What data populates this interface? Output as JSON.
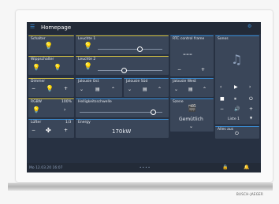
{
  "header": {
    "title": "Homepage"
  },
  "tiles": {
    "schalter": {
      "label": "Schalter"
    },
    "leuchte1": {
      "label": "Leuchte 1"
    },
    "rtc": {
      "label": "RTC control frame",
      "value": "---",
      "minus": "−",
      "plus": "+"
    },
    "sonos": {
      "label": "Sonos",
      "source": "Liste 1"
    },
    "wippschalter": {
      "label": "Wippschalter"
    },
    "leuchte2": {
      "label": "Leuchte 2"
    },
    "dimmer": {
      "label": "Dimmer"
    },
    "jalousie_ost": {
      "label": "Jalousie Ost"
    },
    "jalousie_sued": {
      "label": "Jalousie Süd"
    },
    "jalousie_west": {
      "label": "Jalousie West"
    },
    "rgbw": {
      "label": "RGBW",
      "value": "100%"
    },
    "helligkeit": {
      "label": "Helligkeitsschwelle"
    },
    "szene": {
      "label": "Szene",
      "value": "Gemütlich"
    },
    "luefter": {
      "label": "Lüfter",
      "value": "1/3"
    },
    "energy": {
      "label": "Energy",
      "value": "170kW"
    },
    "alles_aus": {
      "label": "Alles aus"
    }
  },
  "status": {
    "datetime": "Mo 12.03.20  16:07"
  },
  "brand": "BUSCH-JAEGER",
  "colors": {
    "accent_green": "#7fc04a",
    "accent_yellow": "#d8c542",
    "accent_blue": "#3a8fd8",
    "accent_orange": "#e38b2c",
    "accent_red": "#d24a3b"
  }
}
